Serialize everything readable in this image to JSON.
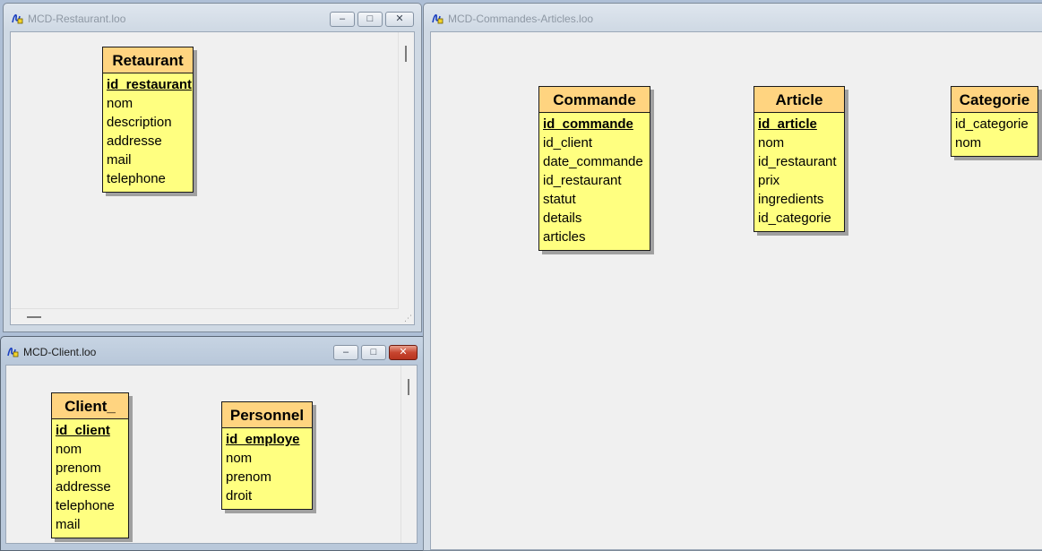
{
  "windows": {
    "restaurant": {
      "title": "MCD-Restaurant.loo",
      "entities": [
        {
          "name": "Retaurant",
          "attributes": [
            "id_restaurant",
            "nom",
            "description",
            "addresse",
            "mail",
            "telephone"
          ],
          "key": "id_restaurant"
        }
      ]
    },
    "client": {
      "title": "MCD-Client.loo",
      "entities": [
        {
          "name": "Client_",
          "attributes": [
            "id_client",
            "nom",
            "prenom",
            "addresse",
            "telephone",
            "mail"
          ],
          "key": "id_client"
        },
        {
          "name": "Personnel",
          "attributes": [
            "id_employe",
            "nom",
            "prenom",
            "droit"
          ],
          "key": "id_employe"
        }
      ]
    },
    "commandes": {
      "title": "MCD-Commandes-Articles.loo",
      "entities": [
        {
          "name": "Commande",
          "attributes": [
            "id_commande",
            "id_client",
            "date_commande",
            "id_restaurant",
            "statut",
            "details",
            "articles"
          ],
          "key": "id_commande"
        },
        {
          "name": "Article",
          "attributes": [
            "id_article",
            "nom",
            "id_restaurant",
            "prix",
            "ingredients",
            "id_categorie"
          ],
          "key": "id_article"
        },
        {
          "name": "Categorie",
          "attributes": [
            "id_categorie",
            "nom"
          ],
          "key": null
        }
      ]
    }
  },
  "controls": {
    "minimize": "–",
    "maximize": "□",
    "close": "✕"
  },
  "colors": {
    "entity_header": "#ffd480",
    "entity_body": "#ffff80",
    "canvas": "#f0f0f0",
    "close_active": "#c7452f"
  }
}
